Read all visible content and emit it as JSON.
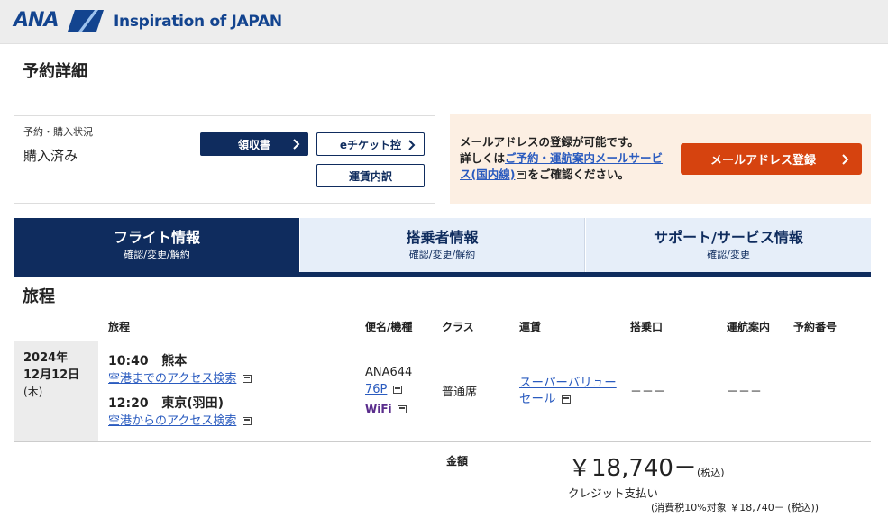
{
  "header": {
    "logo_text": "ANA",
    "tagline": "Inspiration of JAPAN"
  },
  "page_title": "予約詳細",
  "status": {
    "label": "予約・購入状況",
    "value": "購入済み",
    "receipt_button": "領収書",
    "eticket_button": "eチケット控",
    "fare_button": "運賃内訳"
  },
  "email_notice": {
    "line1": "メールアドレスの登録が可能です。",
    "line2_prefix": "詳しくは",
    "link_text": "ご予約・運航案内メールサービス(国内線)",
    "suffix": "をご確認ください。",
    "button": "メールアドレス登録"
  },
  "tabs": [
    {
      "title": "フライト情報",
      "sub": "確認/変更/解約"
    },
    {
      "title": "搭乗者情報",
      "sub": "確認/変更/解約"
    },
    {
      "title": "サポート/サービス情報",
      "sub": "確認/変更"
    }
  ],
  "itinerary": {
    "section_title": "旅程",
    "headers": {
      "route": "旅程",
      "flight": "便名/機種",
      "class": "クラス",
      "fare": "運賃",
      "gate": "搭乗口",
      "status": "運航案内",
      "booking_no": "予約番号"
    },
    "row": {
      "year": "2024年",
      "month_day": "12月12日",
      "weekday": "(木)",
      "dep_time": "10:40",
      "dep_airport": "熊本",
      "dep_access": "空港までのアクセス検索",
      "arr_time": "12:20",
      "arr_airport": "東京(羽田)",
      "arr_access": "空港からのアクセス検索",
      "flight_no": "ANA644",
      "aircraft": "76P",
      "wifi": "WiFi",
      "class": "普通席",
      "fare": "スーパーバリューセール",
      "gate": "－－－",
      "status": "－－－"
    }
  },
  "payment": {
    "label": "金額",
    "amount": "￥18,740－",
    "tax_included": "(税込)",
    "method": "クレジット支払い",
    "tax_detail": "(消費税10%対象 ￥18,740－ (税込))"
  },
  "colors": {
    "brand_navy": "#0f2c5e",
    "logo_blue": "#13448f",
    "link": "#2a5bbf",
    "email_button": "#d6430f",
    "email_bg": "#fcefe3"
  }
}
